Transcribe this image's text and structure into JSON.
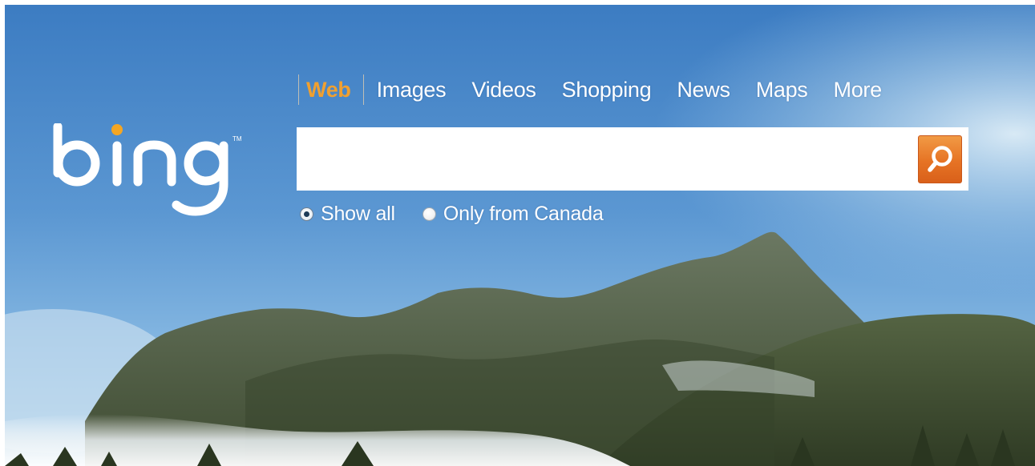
{
  "brand": {
    "logo_text": "bing",
    "trademark": "TM",
    "dot_color": "#f5a623"
  },
  "nav": {
    "items": [
      {
        "label": "Web",
        "active": true
      },
      {
        "label": "Images",
        "active": false
      },
      {
        "label": "Videos",
        "active": false
      },
      {
        "label": "Shopping",
        "active": false
      },
      {
        "label": "News",
        "active": false
      },
      {
        "label": "Maps",
        "active": false
      },
      {
        "label": "More",
        "active": false
      }
    ],
    "active_color": "#f0a030"
  },
  "search": {
    "value": "",
    "placeholder": "",
    "button_icon": "search-icon",
    "button_color": "#e67324"
  },
  "scope": {
    "options": [
      {
        "label": "Show all",
        "checked": true
      },
      {
        "label": "Only from Canada",
        "checked": false
      }
    ]
  },
  "background": {
    "sky_top": "#3f7fc4",
    "sky_bottom": "#8ec0e6",
    "mountain": "#4a5a3a"
  }
}
